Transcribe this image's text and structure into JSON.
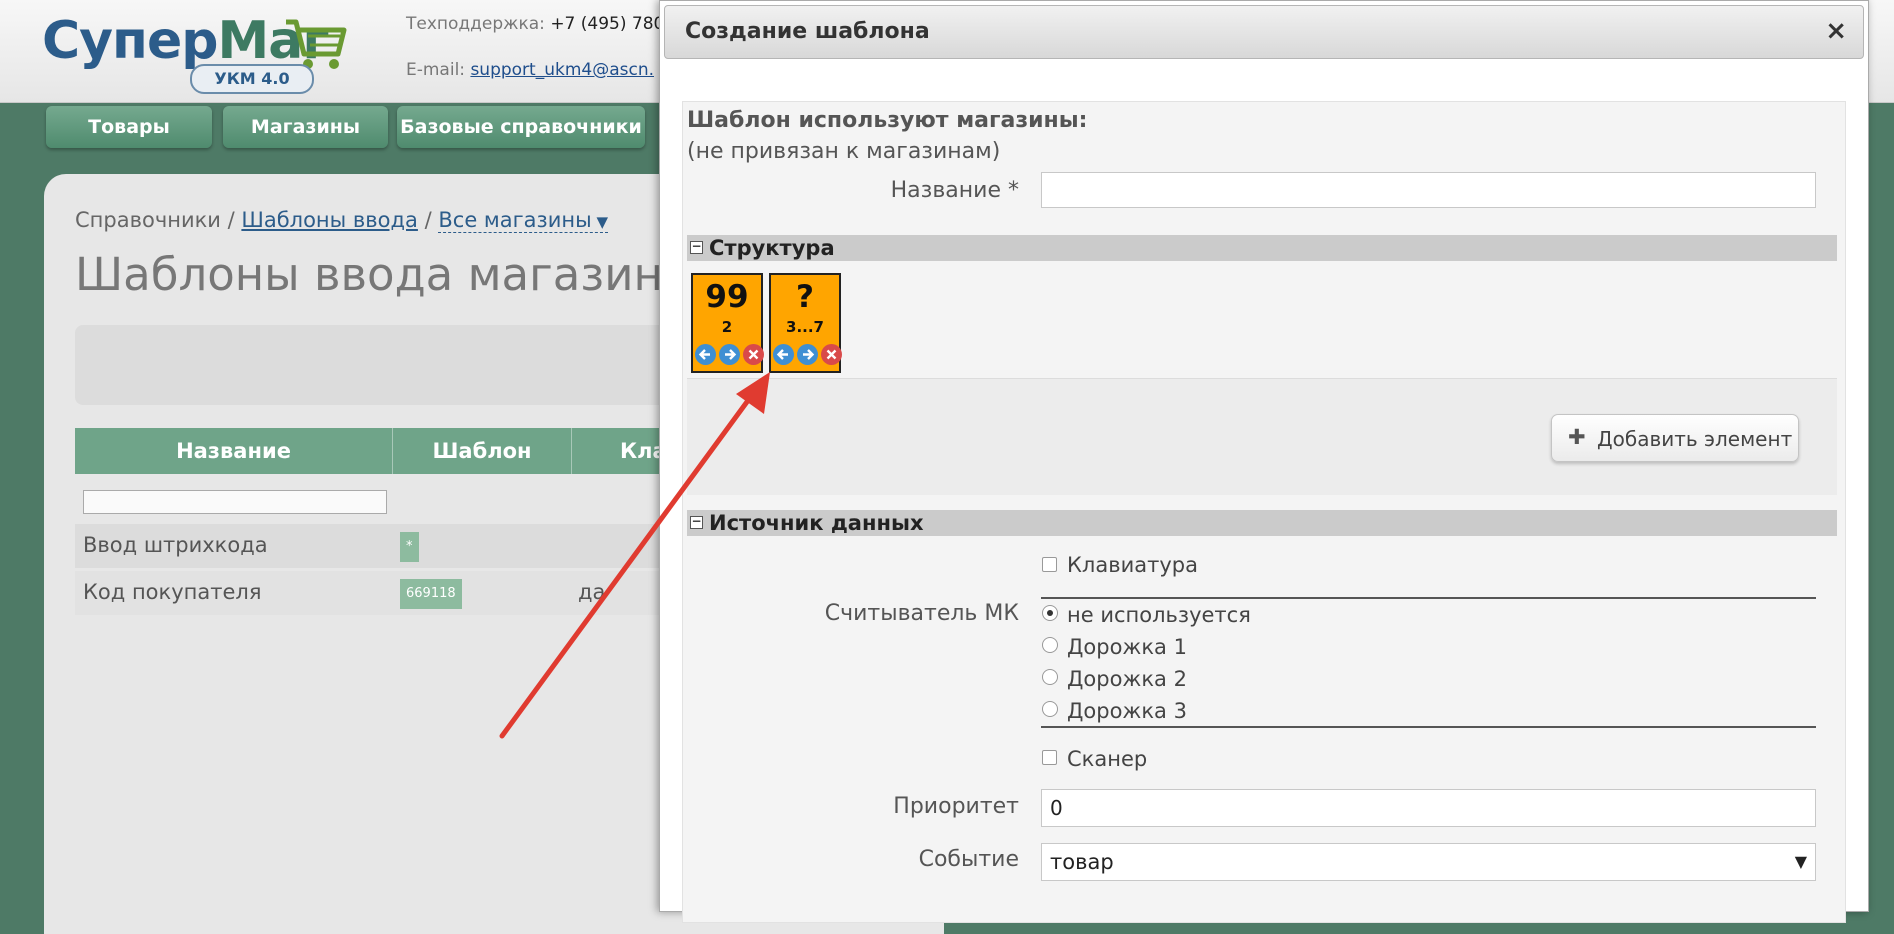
{
  "header": {
    "logo": {
      "word1": "Супер",
      "word2": "Маг",
      "badge": "УКМ 4.0"
    },
    "support_label": "Техподдержка:",
    "support_phone": "+7 (495) 780",
    "email_label": "E-mail:",
    "email_value": "support_ukm4@ascn."
  },
  "nav": {
    "tabs": [
      {
        "label": "Товары"
      },
      {
        "label": "Магазины"
      },
      {
        "label": "Базовые справочники"
      }
    ]
  },
  "page": {
    "breadcrumb": {
      "root": "Справочники",
      "sep": "/",
      "link": "Шаблоны ввода",
      "dropdown": "Все магазины"
    },
    "title": "Шаблоны ввода магазино",
    "table": {
      "headers": [
        "Название",
        "Шаблон",
        "Кла"
      ],
      "rows": [
        {
          "name": "Ввод штрихкода",
          "template": "*",
          "col3": ""
        },
        {
          "name": "Код покупателя",
          "template": "669118",
          "col3": "да"
        }
      ]
    }
  },
  "dialog": {
    "title": "Создание шаблона",
    "close_label": "×",
    "stores_label": "Шаблон используют магазины:",
    "stores_value": "(не привязан к магазинам)",
    "name_label": "Название *",
    "name_value": "",
    "structure": {
      "title": "Структура",
      "toggle": "−",
      "elements": [
        {
          "value": "99",
          "length": "2"
        },
        {
          "value": "?",
          "length": "3...7"
        }
      ],
      "add_button": "Добавить элемент",
      "add_icon": "plus-icon"
    },
    "source": {
      "title": "Источник данных",
      "toggle": "−",
      "keyboard": {
        "label": "Клавиатура",
        "checked": false
      },
      "reader_label": "Считыватель МК",
      "reader_options": [
        {
          "label": "не используется",
          "selected": true
        },
        {
          "label": "Дорожка 1",
          "selected": false
        },
        {
          "label": "Дорожка 2",
          "selected": false
        },
        {
          "label": "Дорожка 3",
          "selected": false
        }
      ],
      "scanner": {
        "label": "Сканер",
        "checked": false
      },
      "priority_label": "Приоритет",
      "priority_value": "0",
      "event_label": "Событие",
      "event_value": "товар",
      "event_caret": "▼"
    }
  },
  "colors": {
    "background": "#4e7a66",
    "tab": "#5e9a7c",
    "tile": "#ffa500",
    "arrow": "#e03b30",
    "link": "#2c5c8a"
  }
}
